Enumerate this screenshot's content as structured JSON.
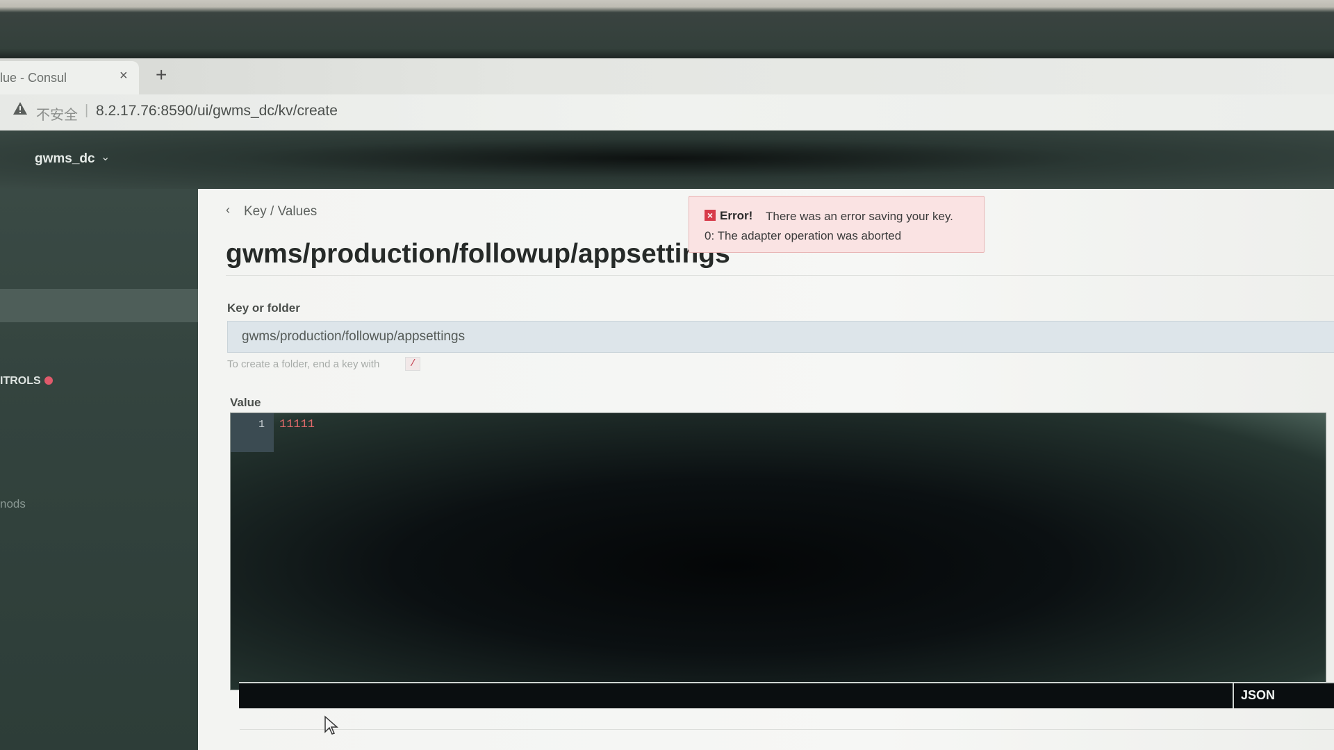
{
  "browser": {
    "tab_title": "lue - Consul",
    "close_glyph": "×",
    "new_tab_glyph": "+",
    "insecure_label": "不安全",
    "url_separator": "|",
    "url": "8.2.17.76:8590/ui/gwms_dc/kv/create"
  },
  "nav": {
    "datacenter": "gwms_dc",
    "chevron": "⌄"
  },
  "sidebar": {
    "controls_label": "ITROLS",
    "methods_label": "nods",
    "status_color": "#e05a6b"
  },
  "breadcrumb": {
    "chevron": "‹",
    "label": "Key / Values"
  },
  "page": {
    "title": "gwms/production/followup/appsettings"
  },
  "error": {
    "icon": "×",
    "heading": "Error!",
    "message": "There was an error saving your key.",
    "detail": "0: The adapter operation was aborted"
  },
  "form": {
    "key_label": "Key or folder",
    "key_value": "gwms/production/followup/appsettings",
    "hint": "To create a folder, end a key with",
    "hint_code": "/",
    "value_label": "Value",
    "editor_line_number": "1",
    "editor_content": "11111",
    "mode": "JSON"
  },
  "colors": {
    "error_bg": "#fae3e3",
    "error_icon": "#d73b4a",
    "code_text": "#e06a6a"
  }
}
